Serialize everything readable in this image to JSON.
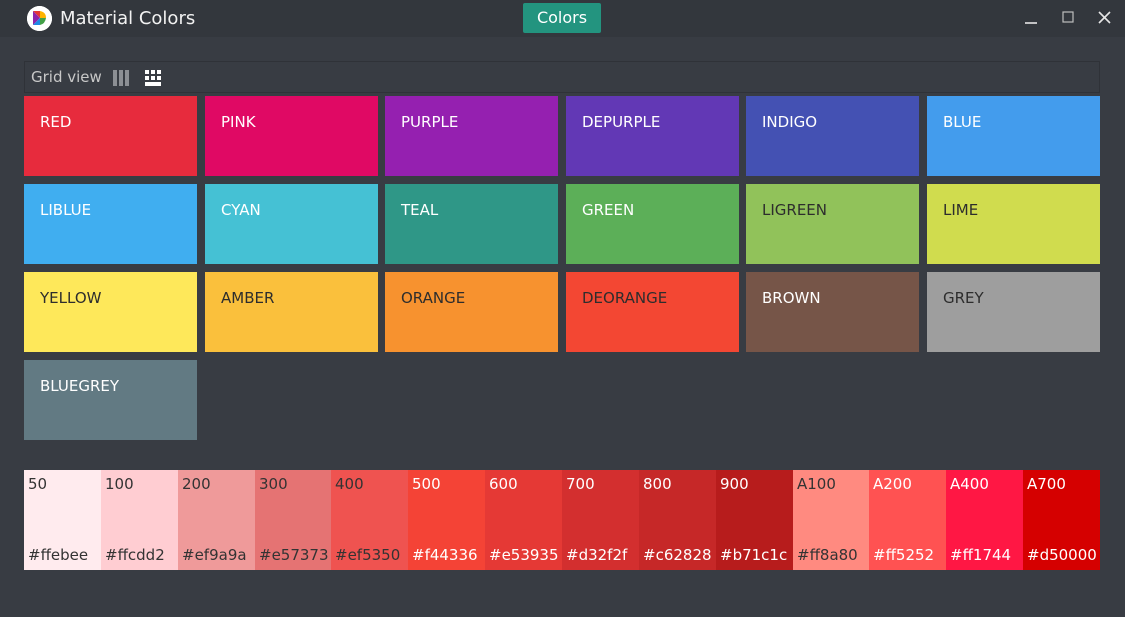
{
  "app": {
    "title": "Material Colors",
    "tab_label": "Colors"
  },
  "view": {
    "label": "Grid view",
    "modes": [
      "list-columns-icon",
      "grid-icon"
    ],
    "active_mode": "grid"
  },
  "colors": [
    {
      "name": "RED",
      "hex": "#e72b3d",
      "text": "#ffffff"
    },
    {
      "name": "PINK",
      "hex": "#e00964",
      "text": "#ffffff"
    },
    {
      "name": "PURPLE",
      "hex": "#9520b0",
      "text": "#ffffff"
    },
    {
      "name": "DEPURPLE",
      "hex": "#6238b5",
      "text": "#ffffff"
    },
    {
      "name": "INDIGO",
      "hex": "#4451b3",
      "text": "#ffffff"
    },
    {
      "name": "BLUE",
      "hex": "#439ced",
      "text": "#ffffff"
    },
    {
      "name": "LIBLUE",
      "hex": "#40aef0",
      "text": "#ffffff"
    },
    {
      "name": "CYAN",
      "hex": "#45c1d4",
      "text": "#ffffff"
    },
    {
      "name": "TEAL",
      "hex": "#2f9787",
      "text": "#ffffff"
    },
    {
      "name": "GREEN",
      "hex": "#5caf58",
      "text": "#ffffff"
    },
    {
      "name": "LIGREEN",
      "hex": "#91c25a",
      "text": "#2d2d2d"
    },
    {
      "name": "LIME",
      "hex": "#d0dc4e",
      "text": "#2d2d2d"
    },
    {
      "name": "YELLOW",
      "hex": "#fee85a",
      "text": "#2d2d2d"
    },
    {
      "name": "AMBER",
      "hex": "#fac03c",
      "text": "#2d2d2d"
    },
    {
      "name": "ORANGE",
      "hex": "#f7922f",
      "text": "#2d2d2d"
    },
    {
      "name": "DEORANGE",
      "hex": "#f34733",
      "text": "#2d2d2d"
    },
    {
      "name": "BROWN",
      "hex": "#765548",
      "text": "#ffffff"
    },
    {
      "name": "GREY",
      "hex": "#9e9e9e",
      "text": "#2d2d2d"
    },
    {
      "name": "BLUEGREY",
      "hex": "#627a83",
      "text": "#ffffff"
    }
  ],
  "shades": [
    {
      "name": "50",
      "hex": "#ffebee",
      "text": "#333333"
    },
    {
      "name": "100",
      "hex": "#ffcdd2",
      "text": "#333333"
    },
    {
      "name": "200",
      "hex": "#ef9a9a",
      "text": "#333333"
    },
    {
      "name": "300",
      "hex": "#e57373",
      "text": "#333333"
    },
    {
      "name": "400",
      "hex": "#ef5350",
      "text": "#333333"
    },
    {
      "name": "500",
      "hex": "#f44336",
      "text": "#ffffff"
    },
    {
      "name": "600",
      "hex": "#e53935",
      "text": "#ffffff"
    },
    {
      "name": "700",
      "hex": "#d32f2f",
      "text": "#ffffff"
    },
    {
      "name": "800",
      "hex": "#c62828",
      "text": "#ffffff"
    },
    {
      "name": "900",
      "hex": "#b71c1c",
      "text": "#ffffff"
    },
    {
      "name": "A100",
      "hex": "#ff8a80",
      "text": "#333333"
    },
    {
      "name": "A200",
      "hex": "#ff5252",
      "text": "#ffffff"
    },
    {
      "name": "A400",
      "hex": "#ff1744",
      "text": "#ffffff"
    },
    {
      "name": "A700",
      "hex": "#d50000",
      "text": "#ffffff"
    }
  ],
  "shade_labels": [
    {
      "name": "50",
      "label": "#ffebee"
    },
    {
      "name": "100",
      "label": "#ffcdd2"
    },
    {
      "name": "200",
      "label": "#ef9a9a"
    },
    {
      "name": "300",
      "label": "#e57373"
    },
    {
      "name": "400",
      "label": "#ef5350"
    },
    {
      "name": "500",
      "label": "#f44336"
    },
    {
      "name": "600",
      "label": "#e53935"
    },
    {
      "name": "700",
      "label": "#d32f2f"
    },
    {
      "name": "800",
      "label": "#c62828"
    },
    {
      "name": "900",
      "label": "#b71c1c"
    },
    {
      "name": "A100",
      "label": "#ff8a80"
    },
    {
      "name": "A200",
      "label": "#ff5252"
    },
    {
      "name": "A400",
      "label": "#ff1744"
    },
    {
      "name": "A700",
      "label": "#d50000"
    }
  ]
}
